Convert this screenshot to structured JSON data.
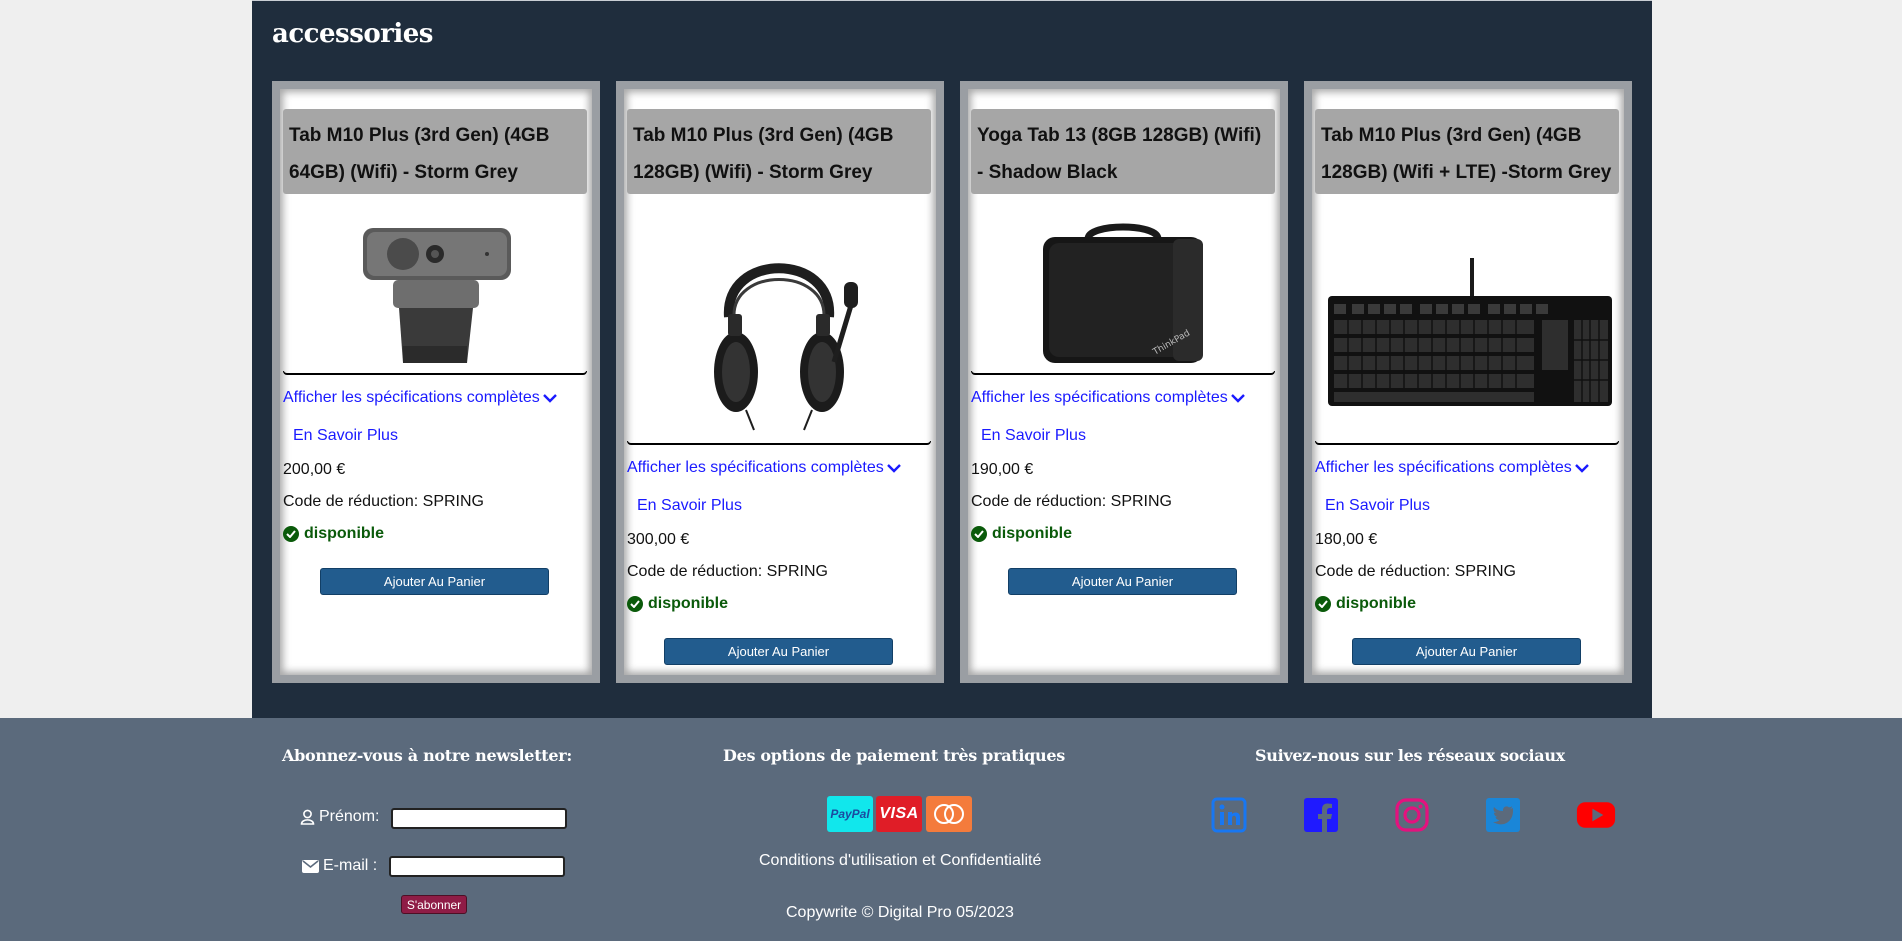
{
  "section": {
    "title": "accessories"
  },
  "products": [
    {
      "title": "Tab M10 Plus (3rd Gen) (4GB 64GB) (Wifi) - Storm Grey",
      "image": "webcam",
      "specs_label": "Afficher les spécifications complètes",
      "learn_more": "En Savoir Plus",
      "price": "200,00 €",
      "promo": "Code de réduction: SPRING",
      "status": "disponible",
      "cart_label": "Ajouter Au Panier"
    },
    {
      "title": "Tab M10 Plus (3rd Gen) (4GB 128GB) (Wifi) - Storm Grey",
      "image": "headset",
      "specs_label": "Afficher les spécifications complètes",
      "learn_more": "En Savoir Plus",
      "price": "300,00 €",
      "promo": "Code de réduction: SPRING",
      "status": "disponible",
      "cart_label": "Ajouter Au Panier"
    },
    {
      "title": "Yoga Tab 13 (8GB 128GB) (Wifi) - Shadow Black",
      "image": "laptop-sleeve",
      "specs_label": "Afficher les spécifications complètes",
      "learn_more": "En Savoir Plus",
      "price": "190,00 €",
      "promo": "Code de réduction: SPRING",
      "status": "disponible",
      "cart_label": "Ajouter Au Panier"
    },
    {
      "title": "Tab M10 Plus (3rd Gen) (4GB 128GB) (Wifi + LTE) -Storm Grey",
      "image": "keyboard",
      "specs_label": "Afficher les spécifications complètes",
      "learn_more": "En Savoir Plus",
      "price": "180,00 €",
      "promo": "Code de réduction: SPRING",
      "status": "disponible",
      "cart_label": "Ajouter Au Panier"
    }
  ],
  "footer": {
    "newsletter": {
      "heading": "Abonnez-vous à notre newsletter:",
      "firstname_label": "Prénom:",
      "email_label": "E-mail :",
      "firstname_value": "",
      "email_value": "",
      "subscribe_label": "S'abonner"
    },
    "payment": {
      "heading": "Des options de paiement très pratiques",
      "logos": [
        "PayPal",
        "VISA",
        "Mastercard"
      ],
      "terms": "Conditions d'utilisation et Confidentialité",
      "copyright": "Copywrite © Digital Pro 05/2023"
    },
    "social": {
      "heading": "Suivez-nous sur les réseaux sociaux",
      "icons": [
        "linkedin-icon",
        "facebook-icon",
        "instagram-icon",
        "twitter-icon",
        "youtube-icon"
      ]
    }
  },
  "colors": {
    "panel": "#1f2d3d",
    "footer": "#5b6a7c",
    "cart_button": "#225c8e",
    "link": "#1a1aff",
    "available": "#0a5a0a",
    "subscribe": "#8f1c46"
  }
}
